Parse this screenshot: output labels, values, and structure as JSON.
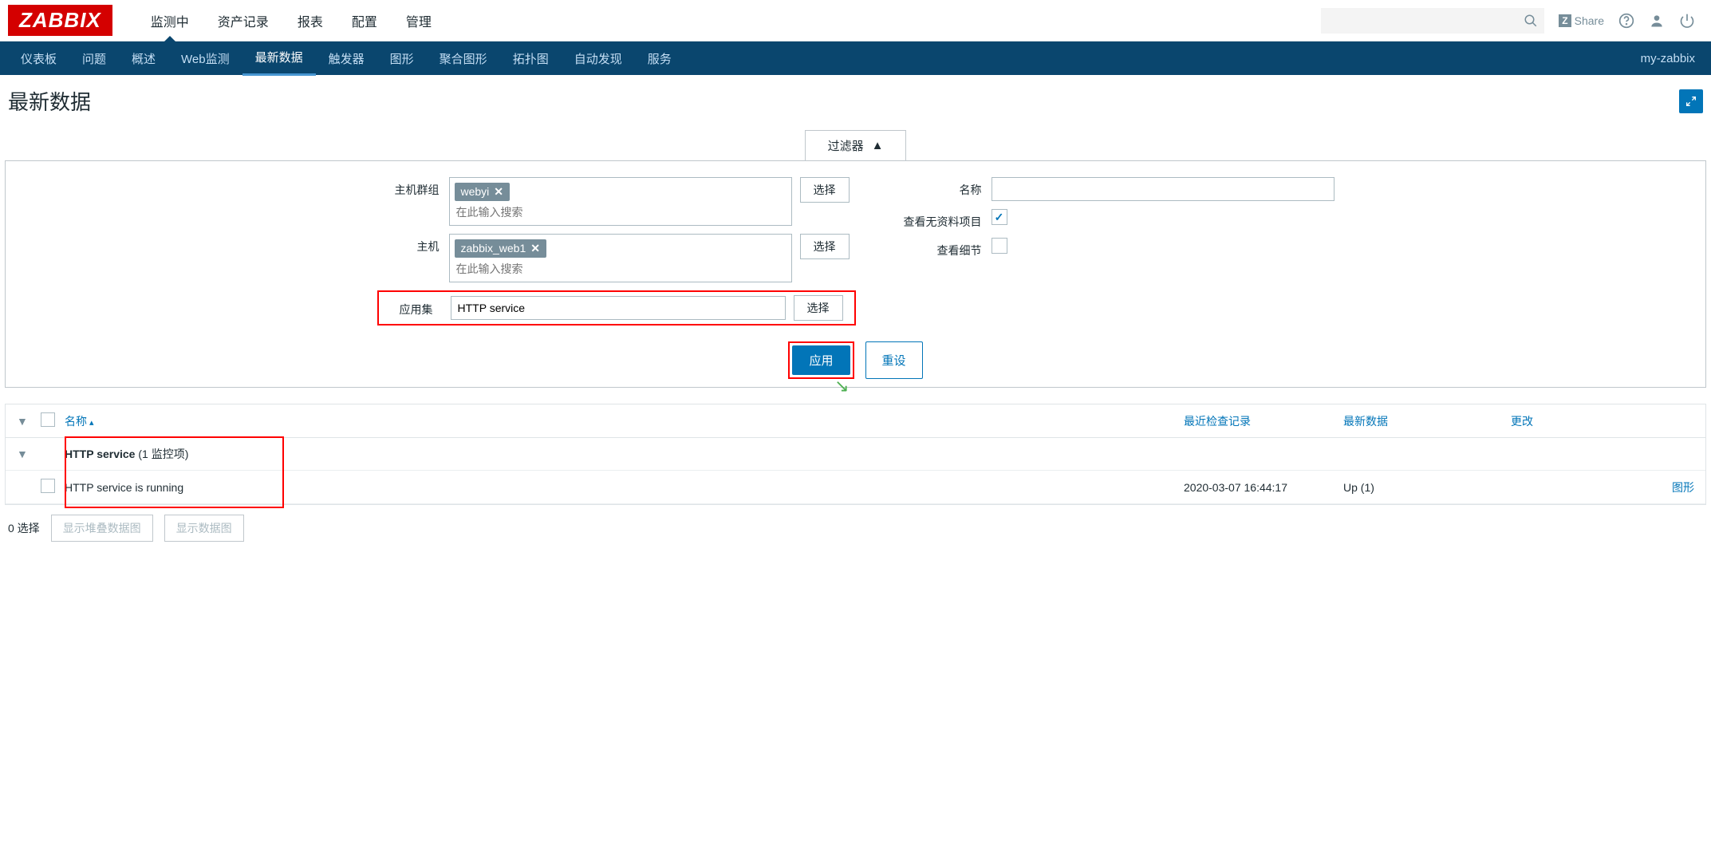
{
  "logo": "ZABBIX",
  "main_menu": [
    "监测中",
    "资产记录",
    "报表",
    "配置",
    "管理"
  ],
  "main_menu_active": 0,
  "share_label": "Share",
  "sub_menu": [
    "仪表板",
    "问题",
    "概述",
    "Web监测",
    "最新数据",
    "触发器",
    "图形",
    "聚合图形",
    "拓扑图",
    "自动发现",
    "服务"
  ],
  "sub_menu_active": 4,
  "sub_nav_right": "my-zabbix",
  "page_title": "最新数据",
  "filter_tab": "过滤器",
  "filter": {
    "host_group_label": "主机群组",
    "host_group_tag": "webyi",
    "host_group_placeholder": "在此输入搜索",
    "host_label": "主机",
    "host_tag": "zabbix_web1",
    "host_placeholder": "在此输入搜索",
    "app_label": "应用集",
    "app_value": "HTTP service",
    "name_label": "名称",
    "name_value": "",
    "show_empty_label": "查看无资料项目",
    "show_details_label": "查看细节",
    "select_btn": "选择",
    "apply_btn": "应用",
    "reset_btn": "重设"
  },
  "table": {
    "col_name": "名称",
    "col_check": "最近检查记录",
    "col_latest": "最新数据",
    "col_change": "更改",
    "group_name": "HTTP service",
    "group_count": "(1 监控项)",
    "item_name": "HTTP service is running",
    "item_check_time": "2020-03-07 16:44:17",
    "item_latest": "Up (1)",
    "item_change": "",
    "graph_link": "图形"
  },
  "footer": {
    "selected": "0 选择",
    "stack_graph": "显示堆叠数据图",
    "data_graph": "显示数据图"
  }
}
